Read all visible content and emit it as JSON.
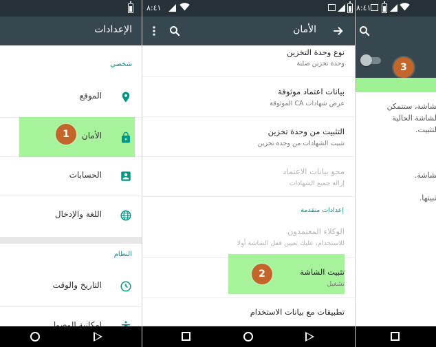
{
  "status": {
    "time": "٨:٤١"
  },
  "settings_screen": {
    "title": "الإعدادات",
    "sections": [
      {
        "header": "شخصي",
        "items": [
          {
            "label": "الموقع",
            "icon": "location-pin-icon"
          },
          {
            "label": "الأمان",
            "icon": "lock-icon"
          },
          {
            "label": "الحسابات",
            "icon": "account-box-icon"
          },
          {
            "label": "اللغة والإدخال",
            "icon": "globe-icon"
          }
        ]
      },
      {
        "header": "النظام",
        "items": [
          {
            "label": "التاريخ والوقت",
            "icon": "clock-icon"
          },
          {
            "label": "إمكانية الوصول",
            "icon": "accessibility-icon"
          }
        ]
      }
    ]
  },
  "security_screen": {
    "title": "الأمان",
    "items": [
      {
        "title": "نوع وحدة التخزين",
        "subtitle": "وحدة تخزين صلبة",
        "enabled": true
      },
      {
        "title": "بيانات اعتماد موثوقة",
        "subtitle": "عرض شهادات CA الموثوقة",
        "enabled": true
      },
      {
        "title": "التثبيت من وحدة تخزين",
        "subtitle": "تثبيت الشهادات من وحدة تخزين",
        "enabled": true
      },
      {
        "title": "محو بيانات الاعتماد",
        "subtitle": "إزالة جميع الشهادات",
        "enabled": false
      }
    ],
    "advanced_header": "إعدادات متقدمة",
    "advanced_items": [
      {
        "title": "الوكلاء المعتمدون",
        "subtitle": "للاستخدام، عليك تعيين قفل الشاشة أولا",
        "enabled": false
      },
      {
        "title": "تثبيت الشاشة",
        "subtitle": "تشغيل",
        "enabled": true
      },
      {
        "title": "تطبيقات مع بيانات الاستخدام",
        "subtitle": "",
        "enabled": true
      }
    ]
  },
  "screen_pinning": {
    "description_lines": [
      "لشاشة، ستتمكن",
      "الشاشة الحالية",
      "التثبيت.",
      "لشاشة.",
      "تثبيتها."
    ]
  },
  "callouts": [
    "1",
    "2",
    "3"
  ],
  "colors": {
    "toolbar": "#37474f",
    "status_bar": "#263238",
    "accent": "#009688",
    "highlight": "#9ef294",
    "badge": "#c4652a"
  }
}
